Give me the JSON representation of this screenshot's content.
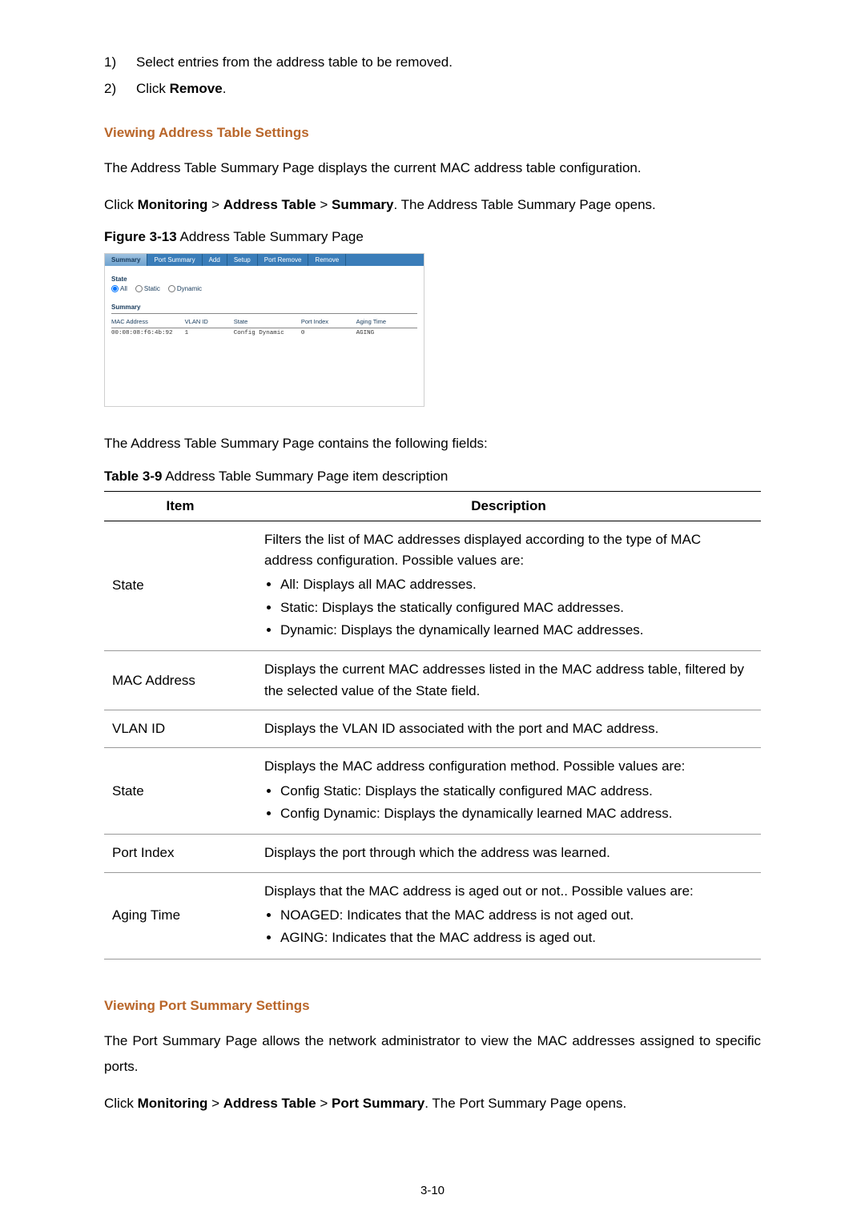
{
  "steps": [
    {
      "num": "1)",
      "text_pre": "Select entries from the address table to be removed.",
      "bold": "",
      "text_post": ""
    },
    {
      "num": "2)",
      "text_pre": "Click ",
      "bold": "Remove",
      "text_post": "."
    }
  ],
  "heading1": "Viewing Address Table Settings",
  "para1": "The Address Table Summary Page displays the current MAC address table configuration.",
  "para2_pre": "Click ",
  "para2_b1": "Monitoring",
  "para2_sep1": " > ",
  "para2_b2": "Address Table",
  "para2_sep2": " > ",
  "para2_b3": "Summary",
  "para2_post": ". The Address Table Summary Page opens.",
  "fig_caption_b": "Figure 3-13",
  "fig_caption_r": " Address Table Summary Page",
  "ui": {
    "tabs": [
      "Summary",
      "Port Summary",
      "Add",
      "Setup",
      "Port Remove",
      "Remove"
    ],
    "active_tab_index": 0,
    "state_label": "State",
    "radios": [
      "All",
      "Static",
      "Dynamic"
    ],
    "checked_radio_index": 0,
    "summary_label": "Summary",
    "cols": [
      "MAC Address",
      "VLAN ID",
      "State",
      "Port Index",
      "Aging Time"
    ],
    "row": [
      "00:08:08:f6:4b:92",
      "1",
      "Config Dynamic",
      "0",
      "AGING"
    ]
  },
  "para3": "The Address Table Summary Page contains the following fields:",
  "table_caption_b": "Table 3-9",
  "table_caption_r": " Address Table Summary Page item description",
  "table": {
    "head_item": "Item",
    "head_desc": "Description",
    "rows": [
      {
        "item": "State",
        "lead": "Filters the list of MAC addresses displayed according to the type of MAC address configuration. Possible values are:",
        "bullets": [
          "All: Displays all MAC addresses.",
          "Static: Displays the statically configured MAC addresses.",
          "Dynamic: Displays the dynamically learned MAC addresses."
        ]
      },
      {
        "item": "MAC Address",
        "lead": "Displays the current MAC addresses listed in the MAC address table, filtered by the selected value of the State field.",
        "bullets": []
      },
      {
        "item": "VLAN ID",
        "lead": "Displays the VLAN ID associated with the port and MAC address.",
        "bullets": []
      },
      {
        "item": "State",
        "lead": "Displays the MAC address configuration method. Possible values are:",
        "bullets": [
          "Config Static: Displays the statically configured MAC address.",
          "Config Dynamic: Displays the dynamically learned MAC address."
        ]
      },
      {
        "item": "Port Index",
        "lead": "Displays the port through which the address was learned.",
        "bullets": []
      },
      {
        "item": "Aging Time",
        "lead": "Displays that the MAC address is aged out or not.. Possible values are:",
        "bullets": [
          "NOAGED: Indicates that the MAC address is not aged out.",
          "AGING: Indicates that the MAC address is aged out."
        ]
      }
    ]
  },
  "heading2": "Viewing Port Summary Settings",
  "para4": "The Port Summary Page allows the network administrator to view the MAC addresses assigned to specific ports.",
  "para5_pre": "Click ",
  "para5_b1": "Monitoring",
  "para5_sep1": " > ",
  "para5_b2": "Address Table",
  "para5_sep2": " > ",
  "para5_b3": "Port Summary",
  "para5_post": ". The Port Summary Page opens.",
  "page_num": "3-10"
}
